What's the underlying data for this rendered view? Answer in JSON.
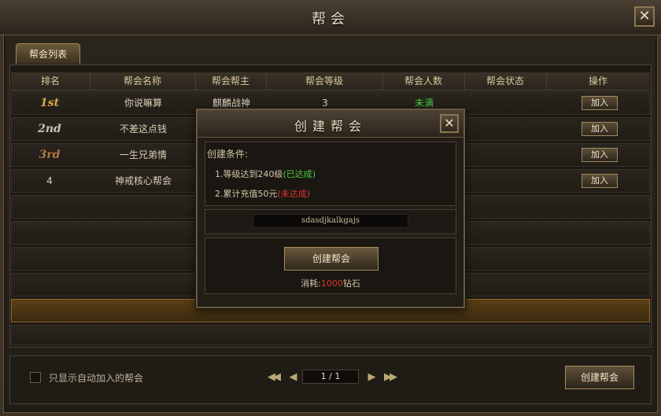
{
  "window": {
    "title": "帮会",
    "close_label": "✕"
  },
  "tab": {
    "label": "帮会列表"
  },
  "table": {
    "headers": [
      "排名",
      "帮会名称",
      "帮会帮主",
      "帮会等级",
      "帮会人数",
      "帮会状态",
      "操作"
    ],
    "rows": [
      {
        "rank": "1st",
        "name": "你说嘛算",
        "leader": "麒麟战神",
        "level": "3",
        "members": "未满",
        "status": "",
        "action": "加入"
      },
      {
        "rank": "2nd",
        "name": "不差这点钱",
        "leader": "",
        "level": "",
        "members": "",
        "status": "",
        "action": "加入"
      },
      {
        "rank": "3rd",
        "name": "一生兄弟情",
        "leader": "",
        "level": "",
        "members": "",
        "status": "",
        "action": "加入"
      },
      {
        "rank": "4",
        "name": "神戒核心帮会",
        "leader": "",
        "level": "",
        "members": "",
        "status": "",
        "action": "加入"
      }
    ]
  },
  "footer": {
    "auto_join_label": "只显示自动加入的帮会",
    "page_display": "1 / 1",
    "first_label": "◀◀",
    "prev_label": "◀",
    "next_label": "▶",
    "last_label": "▶▶",
    "create_label": "创建帮会"
  },
  "modal": {
    "title": "创建帮会",
    "close_label": "✕",
    "conditions_title": "创建条件:",
    "cond1_text": "1.等级达到240级",
    "cond1_status": "(已达成)",
    "cond2_text": "2.累计充值50元",
    "cond2_status": "(未达成)",
    "name_value": "sdasdjkalkgajs",
    "create_label": "创建帮会",
    "cost_prefix": "消耗:",
    "cost_amount": "1000",
    "cost_suffix": "钻石"
  },
  "colors": {
    "achieved": "#4ccb3f",
    "not_achieved": "#e0352a",
    "gold": "#d9c89e"
  }
}
